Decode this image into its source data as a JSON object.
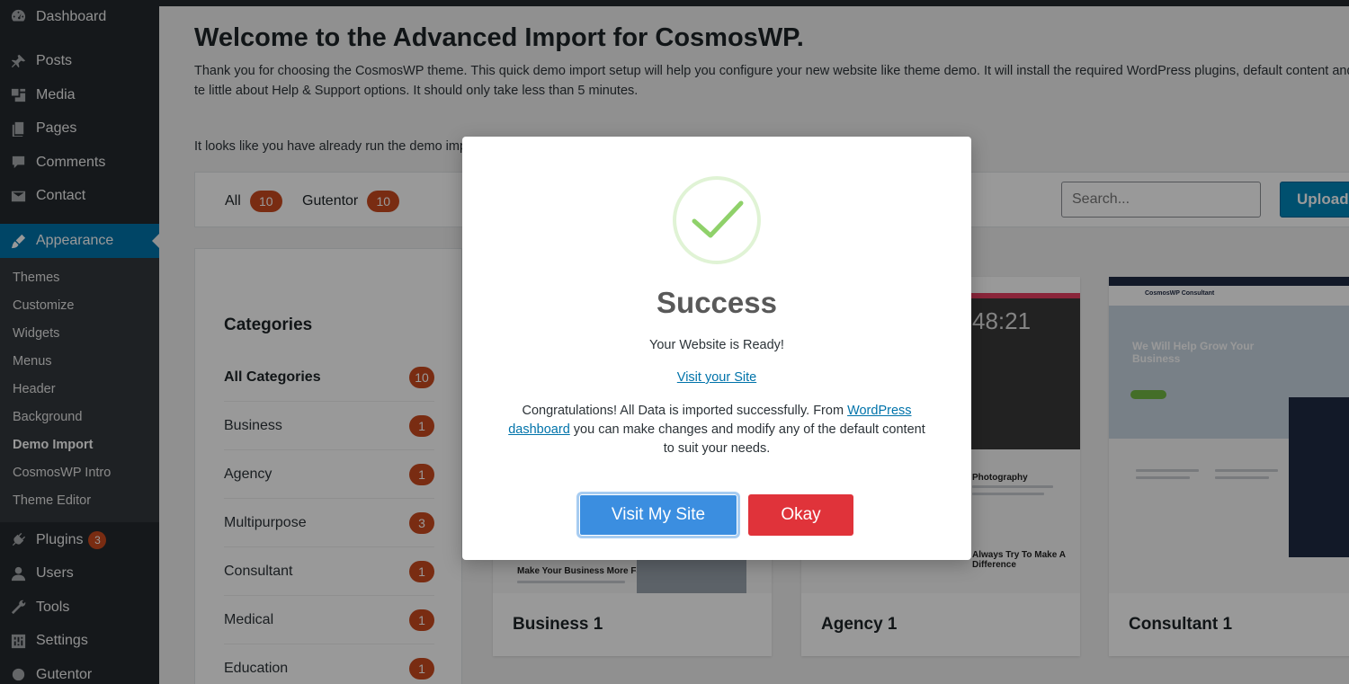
{
  "sidebar": {
    "top_items": [
      {
        "label": "Dashboard",
        "icon": "dashboard-icon"
      },
      {
        "label": "Posts",
        "icon": "pin-icon"
      },
      {
        "label": "Media",
        "icon": "media-icon"
      },
      {
        "label": "Pages",
        "icon": "pages-icon"
      },
      {
        "label": "Comments",
        "icon": "comment-icon"
      },
      {
        "label": "Contact",
        "icon": "mail-icon"
      }
    ],
    "active_item": {
      "label": "Appearance",
      "icon": "paintbrush-icon"
    },
    "submenu": [
      "Themes",
      "Customize",
      "Widgets",
      "Menus",
      "Header",
      "Background",
      "Demo Import",
      "CosmosWP Intro",
      "Theme Editor"
    ],
    "current_submenu": "Demo Import",
    "bottom_items": [
      {
        "label": "Plugins",
        "icon": "plug-icon",
        "badge": "3"
      },
      {
        "label": "Users",
        "icon": "user-icon"
      },
      {
        "label": "Tools",
        "icon": "wrench-icon"
      },
      {
        "label": "Settings",
        "icon": "settings-icon"
      },
      {
        "label": "Gutentor",
        "icon": "gutentor-icon"
      }
    ]
  },
  "main": {
    "title": "Welcome to the Advanced Import for CosmosWP.",
    "intro": "Thank you for choosing the CosmosWP theme. This quick demo import setup will help you configure your new website like theme demo. It will install the required WordPress plugins, default content and te little about Help & Support options. It should only take less than 5 minutes.",
    "already_text": "It looks like you have already run the demo impo",
    "filters": [
      {
        "label": "All",
        "count": "10"
      },
      {
        "label": "Gutentor",
        "count": "10"
      }
    ],
    "search_placeholder": "Search...",
    "upload_label": "Upload",
    "categories_title": "Categories",
    "categories": [
      {
        "label": "All Categories",
        "count": "10"
      },
      {
        "label": "Business",
        "count": "1"
      },
      {
        "label": "Agency",
        "count": "1"
      },
      {
        "label": "Multipurpose",
        "count": "3"
      },
      {
        "label": "Consultant",
        "count": "1"
      },
      {
        "label": "Medical",
        "count": "1"
      },
      {
        "label": "Education",
        "count": "1"
      }
    ],
    "demos": [
      {
        "name": "Business 1",
        "thumb_heading": "Make Your Business More Faster"
      },
      {
        "name": "Agency 1",
        "thumb_heading": "Photography",
        "thumb_heading_2": "Always Try To Make A Difference",
        "thumb_clock": "48:21"
      },
      {
        "name": "Consultant 1",
        "thumb_heading": "We Will Help Grow Your Business",
        "thumb_brand": "CosmosWP Consultant"
      }
    ]
  },
  "modal": {
    "icon": "checkmark-icon",
    "title": "Success",
    "ready": "Your Website is Ready!",
    "visit_link": "Visit your Site",
    "body_before": "Congratulations! All Data is imported successfully. From ",
    "body_link": "WordPress dashboard",
    "body_after": " you can make changes and modify any of the default content to suit your needs.",
    "visit_button": "Visit My Site",
    "okay_button": "Okay"
  },
  "colors": {
    "sidebar_bg": "#23282d",
    "active_blue": "#0073aa",
    "badge_orange": "#ca4a1f",
    "visit_button": "#3b8ee0",
    "okay_button": "#e0333a",
    "success_green": "#8fd16a"
  }
}
